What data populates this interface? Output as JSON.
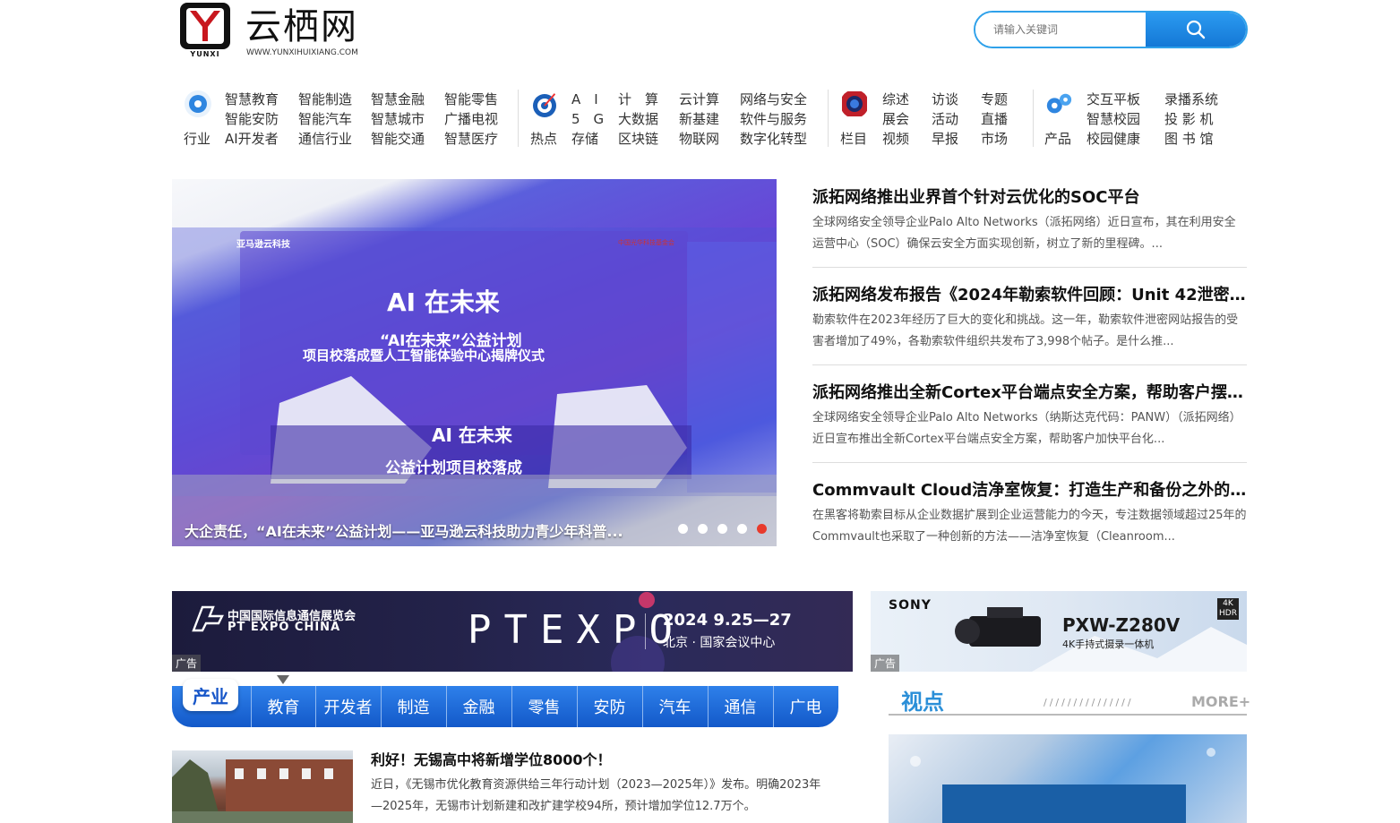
{
  "header": {
    "logo_sub": "YUNXI",
    "site_name": "云栖网",
    "site_url": "WWW.YUNXIHUIXIANG.COM",
    "search_placeholder": "请输入关键词"
  },
  "nav": {
    "industry": {
      "label": "行业",
      "cols": [
        [
          "智慧教育",
          "智能安防",
          "AI开发者"
        ],
        [
          "智能制造",
          "智能汽车",
          "通信行业"
        ],
        [
          "智慧金融",
          "智慧城市",
          "智能交通"
        ],
        [
          "智能零售",
          "广播电视",
          "智慧医疗"
        ]
      ]
    },
    "hot": {
      "label": "热点",
      "cols": [
        [
          "A　I",
          "5　G",
          "存储"
        ],
        [
          "计　算",
          "大数据",
          "区块链"
        ],
        [
          "云计算",
          "新基建",
          "物联网"
        ],
        [
          "网络与安全",
          "软件与服务",
          "数字化转型"
        ]
      ]
    },
    "column": {
      "label": "栏目",
      "cols": [
        [
          "综述",
          "展会",
          "视频"
        ],
        [
          "访谈",
          "活动",
          "早报"
        ],
        [
          "专题",
          "直播",
          "市场"
        ]
      ]
    },
    "product": {
      "label": "产品",
      "cols": [
        [
          "交互平板",
          "智慧校园",
          "校园健康"
        ],
        [
          "录播系统",
          "投 影 机",
          "图 书 馆"
        ]
      ]
    }
  },
  "hero": {
    "caption": "大企责任，“AI在未来”公益计划——亚马逊云科技助力青少年科普...",
    "banner_brand": "亚马逊云科技",
    "banner_org": "中国光华科技基金会",
    "banner_line1": "AI 在未来",
    "banner_line2": "“AI在未来”公益计划",
    "banner_line3": "项目校落成暨人工智能体验中心揭牌仪式",
    "stage_line1": "AI 在未来",
    "stage_line2": "公益计划项目校落成",
    "slides": 5,
    "active_slide": 5
  },
  "news": [
    {
      "title": "派拓网络推出业界首个针对云优化的SOC平台",
      "desc": "全球网络安全领导企业Palo Alto Networks（派拓网络）近日宣布，其在利用安全运营中心（SOC）确保云安全方面实现创新，树立了新的里程碑。..."
    },
    {
      "title": "派拓网络发布报告《2024年勒索软件回顾：Unit 42泄密网站分析》",
      "desc": "勒索软件在2023年经历了巨大的变化和挑战。这一年，勒索软件泄密网站报告的受害者增加了49%，各勒索软件组织共发布了3,998个帖子。是什么推..."
    },
    {
      "title": "派拓网络推出全新Cortex平台端点安全方案，帮助客户摆脱传统防护",
      "desc": "全球网络安全领导企业Palo Alto Networks（纳斯达克代码：PANW）（派拓网络）近日宣布推出全新Cortex平台端点安全方案，帮助客户加快平台化..."
    },
    {
      "title": "Commvault Cloud洁净室恢复：打造生产和备份之外的第三种环境",
      "desc": "在黑客将勒索目标从企业数据扩展到企业运营能力的今天，专注数据领域超过25年的Commvault也采取了一种创新的方法——洁净室恢复（Cleanroom..."
    }
  ],
  "ads": {
    "ad1": {
      "cn": "中国国际信息通信展览会",
      "en": "PT EXPO CHINA",
      "big": "PTEXPO",
      "date": "2024 9.25—27",
      "place": "北京 · 国家会议中心",
      "tag": "广告"
    },
    "ad2": {
      "brand": "SONY",
      "model": "PXW-Z280V",
      "sub": "4K手持式摄录一体机",
      "badge1": "4K",
      "badge2": "HDR",
      "tag": "广告"
    }
  },
  "tabs": {
    "active": "产业",
    "items": [
      "教育",
      "开发者",
      "制造",
      "金融",
      "零售",
      "安防",
      "汽车",
      "通信",
      "广电"
    ]
  },
  "article": {
    "title": "利好！无锡高中将新增学位8000个！",
    "desc": "近日，《无锡市优化教育资源供给三年行动计划（2023—2025年）》发布。明确2023年—2025年，无锡市计划新建和改扩建学校94所，预计增加学位12.7万个。"
  },
  "viewpoint": {
    "title": "视点",
    "slashes": "///////////////",
    "more": "MORE+"
  },
  "colors": {
    "accent": "#1478d6",
    "link_blue": "#2b8fd8",
    "tab_blue": "#1359c9"
  }
}
